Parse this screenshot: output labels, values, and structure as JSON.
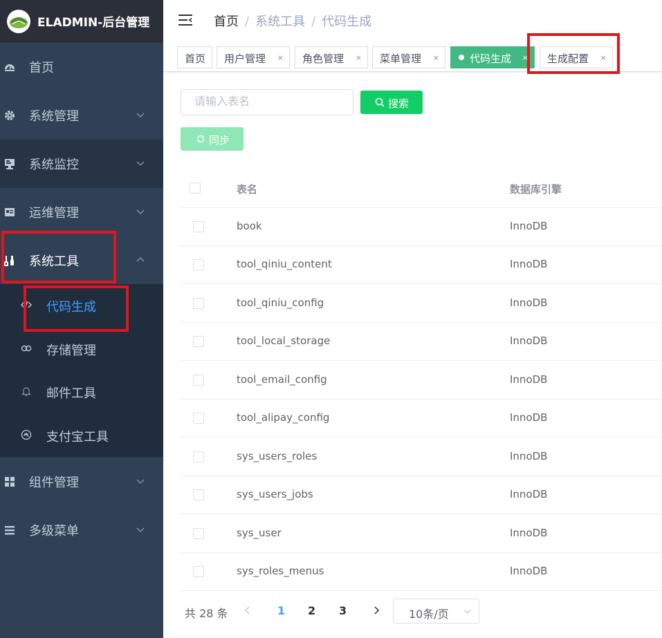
{
  "app": {
    "title": "ELADMIN-后台管理"
  },
  "sidebar": {
    "items": [
      {
        "label": "首页",
        "icon": "dashboard-icon"
      },
      {
        "label": "系统管理",
        "icon": "gear-icon"
      },
      {
        "label": "系统监控",
        "icon": "monitor-icon"
      },
      {
        "label": "运维管理",
        "icon": "server-icon"
      },
      {
        "label": "系统工具",
        "icon": "tools-icon"
      },
      {
        "label": "组件管理",
        "icon": "grid-icon"
      },
      {
        "label": "多级菜单",
        "icon": "list-icon"
      }
    ],
    "submenu": [
      {
        "label": "代码生成",
        "icon": "code-icon"
      },
      {
        "label": "存储管理",
        "icon": "storage-icon"
      },
      {
        "label": "邮件工具",
        "icon": "bell-icon"
      },
      {
        "label": "支付宝工具",
        "icon": "alipay-icon"
      }
    ]
  },
  "breadcrumb": {
    "home": "首页",
    "sep": "/",
    "level1": "系统工具",
    "level2": "代码生成"
  },
  "tags": [
    {
      "label": "首页"
    },
    {
      "label": "用户管理",
      "close": "×"
    },
    {
      "label": "角色管理",
      "close": "×"
    },
    {
      "label": "菜单管理",
      "close": "×"
    },
    {
      "label": "代码生成",
      "close": "×"
    },
    {
      "label": "生成配置",
      "close": "×"
    }
  ],
  "search": {
    "placeholder": "请输入表名",
    "button": "搜索"
  },
  "sync": {
    "button": "同步"
  },
  "table": {
    "headers": [
      "表名",
      "数据库引擎"
    ],
    "rows": [
      {
        "name": "book",
        "engine": "InnoDB"
      },
      {
        "name": "tool_qiniu_content",
        "engine": "InnoDB"
      },
      {
        "name": "tool_qiniu_config",
        "engine": "InnoDB"
      },
      {
        "name": "tool_local_storage",
        "engine": "InnoDB"
      },
      {
        "name": "tool_email_config",
        "engine": "InnoDB"
      },
      {
        "name": "tool_alipay_config",
        "engine": "InnoDB"
      },
      {
        "name": "sys_users_roles",
        "engine": "InnoDB"
      },
      {
        "name": "sys_users_jobs",
        "engine": "InnoDB"
      },
      {
        "name": "sys_user",
        "engine": "InnoDB"
      },
      {
        "name": "sys_roles_menus",
        "engine": "InnoDB"
      }
    ]
  },
  "pagination": {
    "total": "共 28 条",
    "pages": [
      "1",
      "2",
      "3"
    ],
    "current": "1",
    "size": "10条/页"
  },
  "colors": {
    "sidebar": "#304156",
    "accent": "#409eff",
    "success": "#13ce66",
    "tag_active": "#42b983",
    "highlight": "#e0161c"
  }
}
